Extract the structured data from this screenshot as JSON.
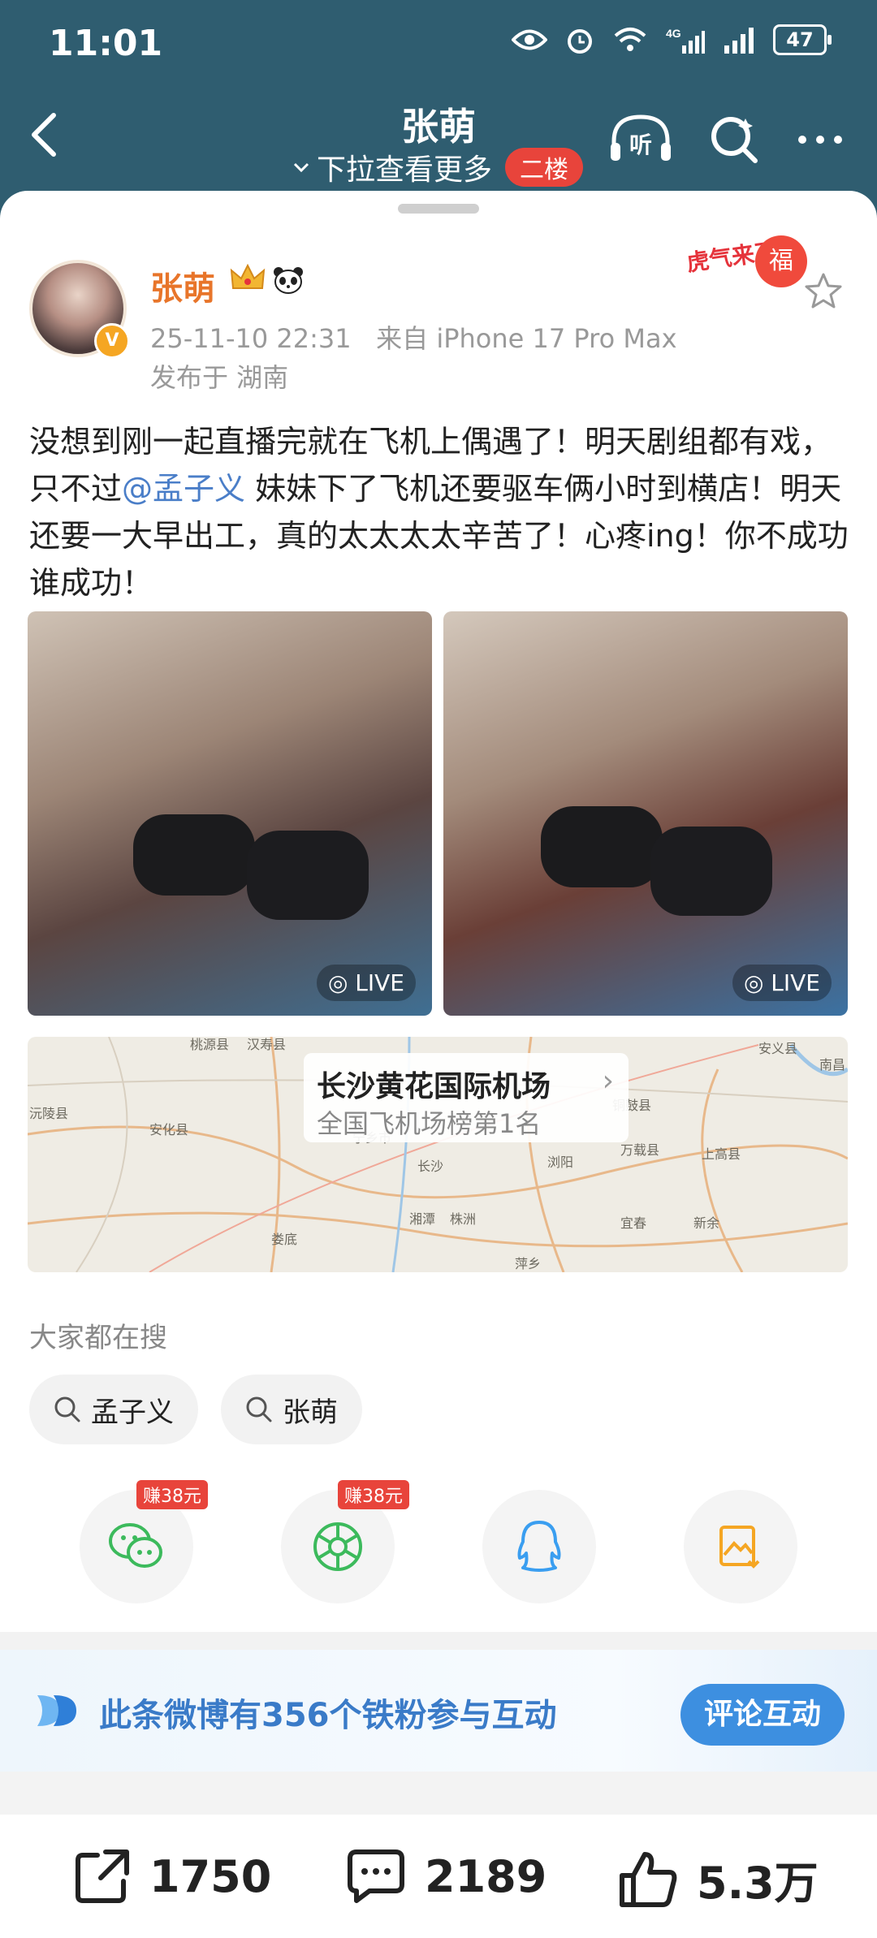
{
  "status_bar": {
    "time": "11:01",
    "battery": "47"
  },
  "nav": {
    "title": "张萌",
    "subtitle": "下拉查看更多",
    "subtitle_badge": "二楼",
    "listen_label": "听"
  },
  "post": {
    "username": "张萌",
    "verified_badge": "V",
    "date": "25-11-10 22:31",
    "source": "来自 iPhone 17 Pro Max",
    "location": "发布于 湖南",
    "tiger_badge": "虎气来了",
    "tiger_paw": "福",
    "text_before": "没想到刚一起直播完就在飞机上偶遇了！明天剧组都有戏，只不过",
    "mention": "@孟子义",
    "text_after": " 妹妹下了飞机还要驱车俩小时到横店！明天还要一大早出工，真的太太太太辛苦了！心疼ing！你不成功谁成功！",
    "images": [
      {
        "live_label": "LIVE"
      },
      {
        "live_label": "LIVE"
      }
    ]
  },
  "map": {
    "place_name": "长沙黄花国际机场",
    "place_sub": "全国飞机场榜第1名",
    "labels": [
      "长沙",
      "湘潭",
      "株洲",
      "安化县",
      "萍乡",
      "宜春",
      "新余",
      "娄底",
      "浏阳",
      "上高县",
      "铜鼓县",
      "万载县",
      "宁乡市",
      "汉寿县",
      "桃源县",
      "沅陵县",
      "安义县",
      "南昌"
    ]
  },
  "search": {
    "heading": "大家都在搜",
    "chips": [
      "孟子义",
      "张萌"
    ]
  },
  "share": {
    "earn_label": "赚38元",
    "items": [
      "wechat-icon",
      "moments-icon",
      "qq-icon",
      "save-image-icon"
    ]
  },
  "banner": {
    "text": "此条微博有356个铁粉参与互动",
    "button": "评论互动"
  },
  "actions": {
    "reposts": "1750",
    "comments": "2189",
    "likes": "5.3万"
  }
}
